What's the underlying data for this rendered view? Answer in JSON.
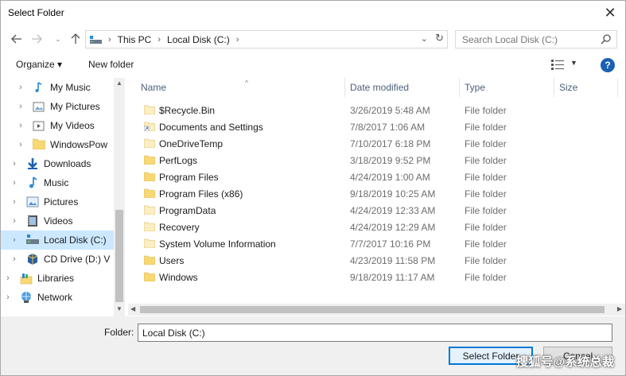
{
  "window": {
    "title": "Select Folder"
  },
  "nav": {
    "breadcrumb": [
      "This PC",
      "Local Disk (C:)"
    ],
    "search_placeholder": "Search Local Disk (C:)"
  },
  "toolbar": {
    "organize_label": "Organize ▾",
    "new_folder_label": "New folder"
  },
  "tree": [
    {
      "label": "My Music",
      "icon": "music-folder-icon",
      "level": 2
    },
    {
      "label": "My Pictures",
      "icon": "pictures-folder-icon",
      "level": 2
    },
    {
      "label": "My Videos",
      "icon": "videos-folder-icon",
      "level": 2
    },
    {
      "label": "WindowsPow",
      "icon": "folder-icon",
      "level": 2
    },
    {
      "label": "Downloads",
      "icon": "downloads-icon",
      "level": 1
    },
    {
      "label": "Music",
      "icon": "music-icon",
      "level": 1
    },
    {
      "label": "Pictures",
      "icon": "pictures-icon",
      "level": 1
    },
    {
      "label": "Videos",
      "icon": "videos-icon",
      "level": 1
    },
    {
      "label": "Local Disk (C:)",
      "icon": "local-disk-icon",
      "level": 1,
      "selected": true
    },
    {
      "label": "CD Drive (D:) V",
      "icon": "cd-drive-icon",
      "level": 1
    },
    {
      "label": "Libraries",
      "icon": "libraries-icon",
      "level": 0
    },
    {
      "label": "Network",
      "icon": "network-icon",
      "level": 0
    }
  ],
  "columns": {
    "name": "Name",
    "date": "Date modified",
    "type": "Type",
    "size": "Size"
  },
  "files": [
    {
      "name": "$Recycle.Bin",
      "date": "3/26/2019 5:48 AM",
      "type": "File folder",
      "style": "pale"
    },
    {
      "name": "Documents and Settings",
      "date": "7/8/2017 1:06 AM",
      "type": "File folder",
      "style": "shortcut"
    },
    {
      "name": "OneDriveTemp",
      "date": "7/10/2017 6:18 PM",
      "type": "File folder",
      "style": "pale"
    },
    {
      "name": "PerfLogs",
      "date": "3/18/2019 9:52 PM",
      "type": "File folder",
      "style": "normal"
    },
    {
      "name": "Program Files",
      "date": "4/24/2019 1:00 AM",
      "type": "File folder",
      "style": "normal"
    },
    {
      "name": "Program Files (x86)",
      "date": "9/18/2019 10:25 AM",
      "type": "File folder",
      "style": "normal"
    },
    {
      "name": "ProgramData",
      "date": "4/24/2019 12:33 AM",
      "type": "File folder",
      "style": "pale"
    },
    {
      "name": "Recovery",
      "date": "4/24/2019 12:29 AM",
      "type": "File folder",
      "style": "pale"
    },
    {
      "name": "System Volume Information",
      "date": "7/7/2017 10:16 PM",
      "type": "File folder",
      "style": "pale"
    },
    {
      "name": "Users",
      "date": "4/23/2019 11:58 PM",
      "type": "File folder",
      "style": "normal"
    },
    {
      "name": "Windows",
      "date": "9/18/2019 11:17 AM",
      "type": "File folder",
      "style": "normal"
    }
  ],
  "footer": {
    "folder_label": "Folder:",
    "folder_value": "Local Disk (C:)",
    "select_label": "Select Folder",
    "cancel_label": "Cancel",
    "watermark": "搜狐号@系统总裁"
  },
  "colors": {
    "accent": "#0078d7",
    "selection": "#cce8ff",
    "folder": "#f8d775",
    "folder_pale": "#fbeec4",
    "help": "#1a61b3"
  }
}
